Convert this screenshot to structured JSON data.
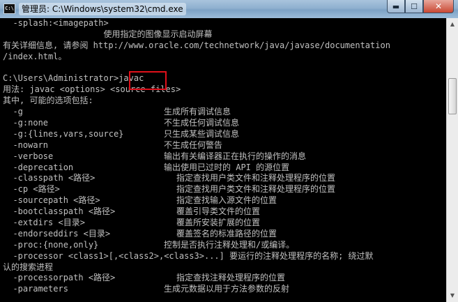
{
  "window": {
    "title": "管理员: C:\\Windows\\system32\\cmd.exe",
    "app_icon": "C:\\",
    "buttons": {
      "minimize": "▬",
      "maximize": "☐",
      "close": "✕"
    }
  },
  "console": {
    "lines": [
      {
        "l": "  -splash:<imagepath>"
      },
      {
        "l": "                    使用指定的图像显示启动屏幕"
      },
      {
        "l": "有关详细信息, 请参阅 http://www.oracle.com/technetwork/java/javase/documentation"
      },
      {
        "l": "/index.html。"
      },
      {
        "l": ""
      },
      {
        "l": "C:\\Users\\Administrator>javac"
      },
      {
        "l": "用法: javac <options> <source files>"
      },
      {
        "l": "其中, 可能的选项包括:"
      },
      {
        "l": "  -g",
        "r": "生成所有调试信息"
      },
      {
        "l": "  -g:none",
        "r": "不生成任何调试信息"
      },
      {
        "l": "  -g:{lines,vars,source}",
        "r": "只生成某些调试信息"
      },
      {
        "l": "  -nowarn",
        "r": "不生成任何警告"
      },
      {
        "l": "  -verbose",
        "r": "输出有关编译器正在执行的操作的消息"
      },
      {
        "l": "  -deprecation",
        "r": "输出使用已过时的 API 的源位置"
      },
      {
        "l": "  -classpath <路径>",
        "r": "指定查找用户类文件和注释处理程序的位置",
        "indent": "deep"
      },
      {
        "l": "  -cp <路径>",
        "r": "指定查找用户类文件和注释处理程序的位置",
        "indent": "deep"
      },
      {
        "l": "  -sourcepath <路径>",
        "r": "指定查找输入源文件的位置",
        "indent": "deep"
      },
      {
        "l": "  -bootclasspath <路径>",
        "r": "覆盖引导类文件的位置",
        "indent": "deep"
      },
      {
        "l": "  -extdirs <目录>",
        "r": "覆盖所安装扩展的位置",
        "indent": "deep"
      },
      {
        "l": "  -endorseddirs <目录>",
        "r": "覆盖签名的标准路径的位置",
        "indent": "deep"
      },
      {
        "l": "  -proc:{none,only}",
        "r": "控制是否执行注释处理和/或编译。"
      },
      {
        "l": "  -processor <class1>[,<class2>,<class3>...] 要运行的注释处理程序的名称; 绕过默"
      },
      {
        "l": "认的搜索进程"
      },
      {
        "l": "  -processorpath <路径>",
        "r": "指定查找注释处理程序的位置",
        "indent": "deep"
      },
      {
        "l": "  -parameters",
        "r": "生成元数据以用于方法参数的反射"
      }
    ]
  },
  "highlight": {
    "text": "javac",
    "color": "#e0101a"
  },
  "scrollbar": {
    "up": "▲",
    "down": "▼"
  }
}
